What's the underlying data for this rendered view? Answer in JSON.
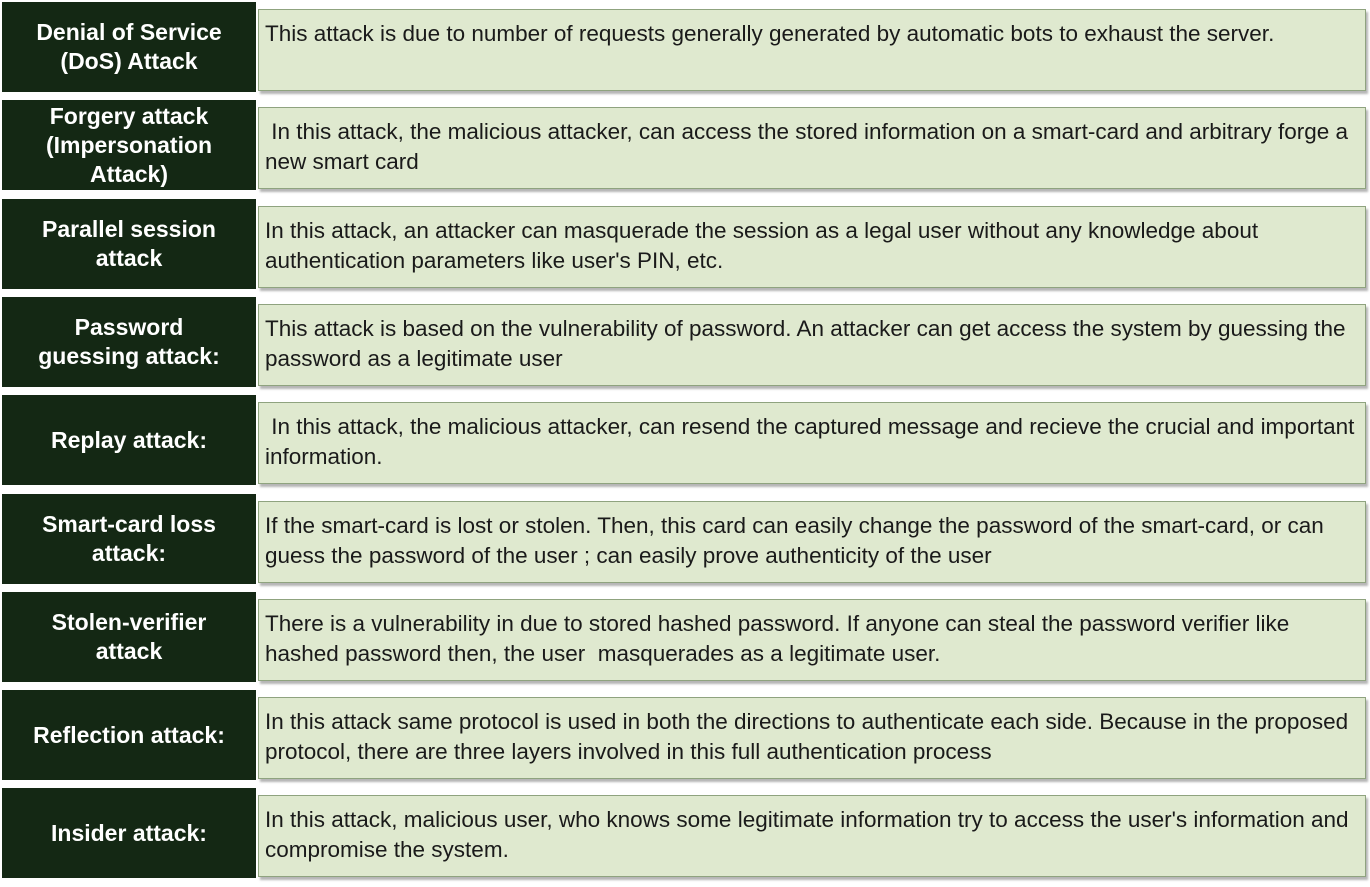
{
  "rows": [
    {
      "label": "Denial of Service\n(DoS) Attack",
      "description": "This attack is due to number of requests generally generated by automatic bots to exhaust the server."
    },
    {
      "label": "Forgery attack\n(Impersonation\nAttack)",
      "description": " In this attack, the malicious attacker, can access the stored information on a smart-card and arbitrary forge a new smart card"
    },
    {
      "label": "Parallel session\nattack",
      "description": "In this attack, an attacker can masquerade the session as a legal user without any knowledge about authentication parameters like user's PIN, etc."
    },
    {
      "label": "Password\nguessing attack:",
      "description": "This attack is based on the vulnerability of password. An attacker can get access the system by guessing the password as a legitimate user"
    },
    {
      "label": "Replay attack:",
      "description": " In this attack, the malicious attacker, can resend the captured message and recieve the crucial and important information."
    },
    {
      "label": "Smart-card loss\nattack:",
      "description": "If the smart-card is lost or stolen. Then, this card can easily change the password of the smart-card, or can guess the password of the user ; can easily prove authenticity of the user"
    },
    {
      "label": "Stolen-verifier\nattack",
      "description": "There is a vulnerability in due to stored hashed password. If anyone can steal the password verifier like hashed password then, the user  masquerades as a legitimate user."
    },
    {
      "label": "Reflection attack:",
      "description": "In this attack same protocol is used in both the directions to authenticate each side. Because in the proposed protocol, there are three layers involved in this full authentication process"
    },
    {
      "label": "Insider attack:",
      "description": "In this attack, malicious user, who knows some legitimate information try to access the user's information and compromise the system."
    }
  ],
  "colors": {
    "label_background": "#142814",
    "label_text": "#ffffff",
    "description_background": "#dfe9cf",
    "description_border": "#8fa37f"
  }
}
